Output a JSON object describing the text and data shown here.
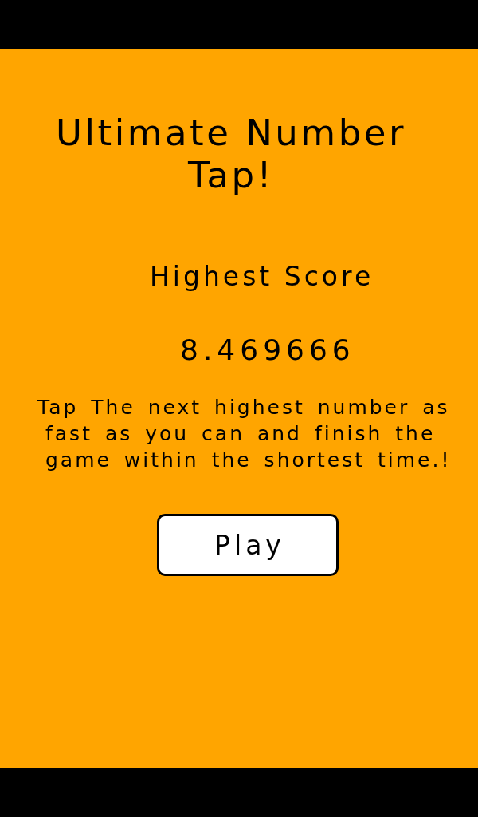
{
  "title": "Ultimate Number Tap!",
  "score_label": "Highest Score",
  "score": "8.469666",
  "instructions": "Tap The next highest number as fast as you can and finish the game within the shortest time.!",
  "play_button": {
    "label": "Play"
  }
}
